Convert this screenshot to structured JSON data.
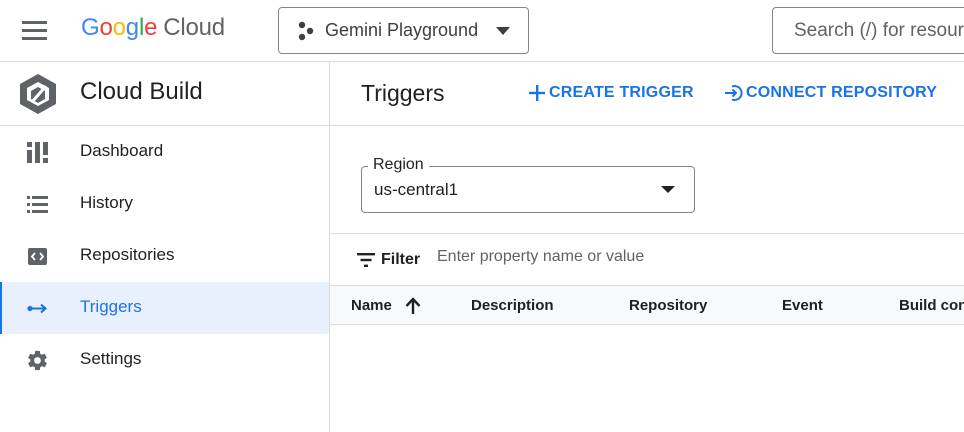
{
  "topbar": {
    "logo_google_letters": [
      "G",
      "o",
      "o",
      "g",
      "l",
      "e"
    ],
    "logo_cloud": "Cloud",
    "project_name": "Gemini Playground",
    "search_placeholder": "Search (/) for resources"
  },
  "sidebar": {
    "product_title": "Cloud Build",
    "items": [
      {
        "label": "Dashboard",
        "icon": "dashboard-icon",
        "active": false
      },
      {
        "label": "History",
        "icon": "list-icon",
        "active": false
      },
      {
        "label": "Repositories",
        "icon": "code-icon",
        "active": false
      },
      {
        "label": "Triggers",
        "icon": "trigger-arrow-icon",
        "active": true
      },
      {
        "label": "Settings",
        "icon": "gear-icon",
        "active": false
      }
    ]
  },
  "main": {
    "title": "Triggers",
    "create_label": "CREATE TRIGGER",
    "connect_label": "CONNECT REPOSITORY",
    "region": {
      "label": "Region",
      "value": "us-central1"
    },
    "filter": {
      "label": "Filter",
      "placeholder": "Enter property name or value"
    },
    "columns": [
      "Name",
      "Description",
      "Repository",
      "Event",
      "Build con"
    ]
  },
  "colors": {
    "accent": "#1a73e8",
    "active_bg": "#e8f0fe",
    "border": "#dadce0",
    "icon_gray": "#5f6368"
  }
}
